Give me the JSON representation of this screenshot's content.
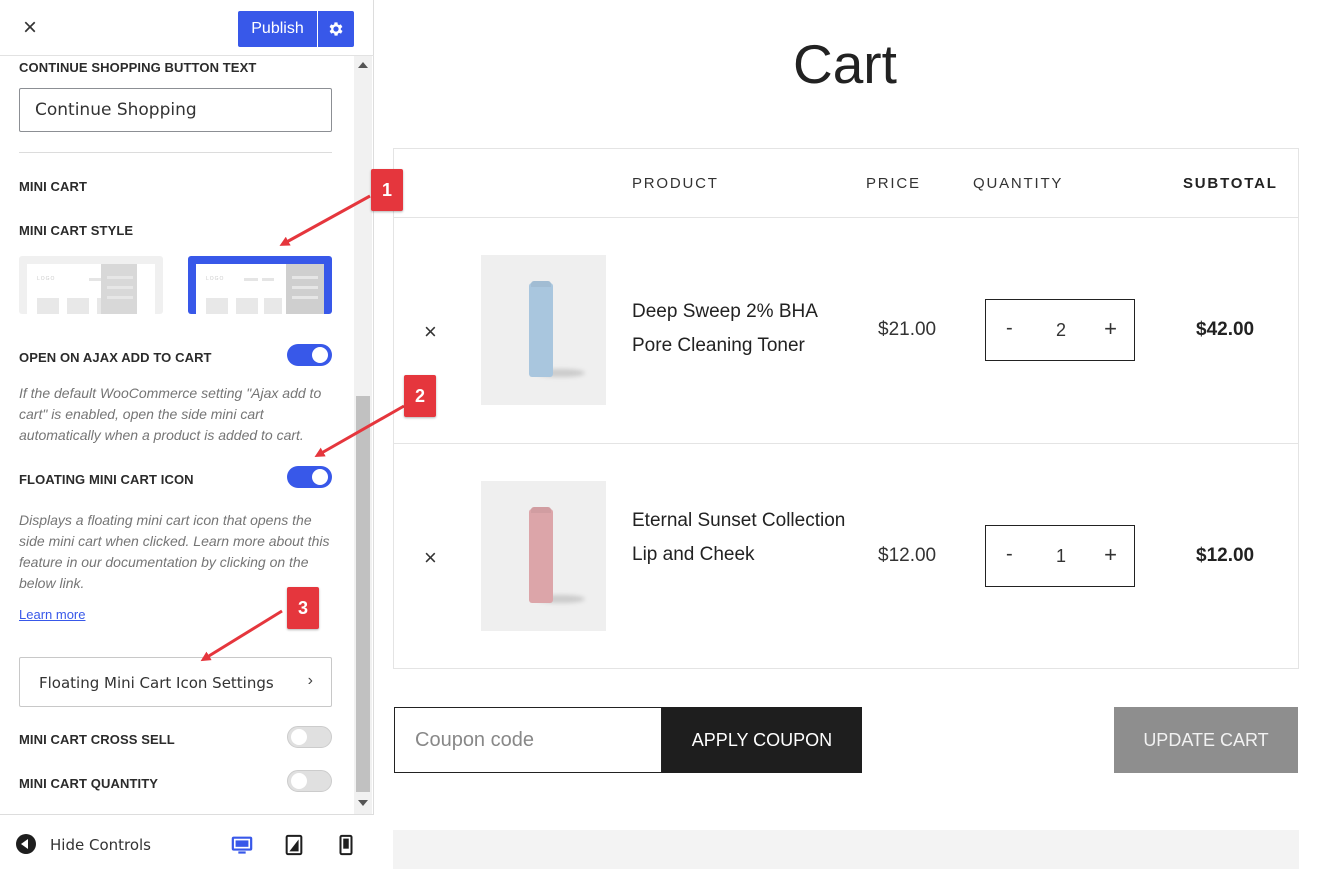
{
  "header": {
    "close_label": "×",
    "publish_label": "Publish"
  },
  "settings": {
    "continue_shopping_label": "CONTINUE SHOPPING BUTTON TEXT",
    "continue_shopping_value": "Continue Shopping",
    "mini_cart_heading": "MINI CART",
    "mini_cart_style_label": "MINI CART STYLE",
    "mini_cart_style_logo_text": "LOGO",
    "open_on_ajax_label": "OPEN ON AJAX ADD TO CART",
    "open_on_ajax_desc": "If the default WooCommerce setting \"Ajax add to cart\" is enabled, open the side mini cart automatically when a product is added to cart.",
    "floating_icon_label": "FLOATING MINI CART ICON",
    "floating_icon_desc": "Displays a floating mini cart icon that opens the side mini cart when clicked. Learn more about this feature in our documentation by clicking on the below link.",
    "learn_more": "Learn more",
    "floating_settings_button": "Floating Mini Cart Icon Settings",
    "cross_sell_label": "MINI CART CROSS SELL",
    "quantity_label": "MINI CART QUANTITY"
  },
  "toggles": {
    "open_on_ajax": true,
    "floating_icon": true,
    "cross_sell": false,
    "quantity": false
  },
  "footer": {
    "hide_controls": "Hide Controls"
  },
  "cart": {
    "title": "Cart",
    "columns": [
      "PRODUCT",
      "PRICE",
      "QUANTITY",
      "SUBTOTAL"
    ],
    "items": [
      {
        "name": "Deep Sweep 2% BHA Pore Cleaning Toner",
        "price": "$21.00",
        "qty": "2",
        "subtotal": "$42.00",
        "bottle_color": "#a9c6de"
      },
      {
        "name": "Eternal Sunset Collection Lip and Cheek",
        "price": "$12.00",
        "qty": "1",
        "subtotal": "$12.00",
        "bottle_color": "#dca5a9"
      }
    ],
    "coupon_placeholder": "Coupon code",
    "apply_coupon": "APPLY COUPON",
    "update_cart": "UPDATE CART",
    "remove_symbol": "×",
    "minus": "-",
    "plus": "+"
  },
  "annotations": [
    "1",
    "2",
    "3"
  ],
  "colors": {
    "accent": "#3858e9",
    "badge": "#e5363d"
  }
}
